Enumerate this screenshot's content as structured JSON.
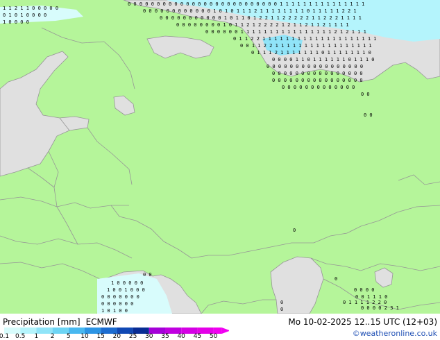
{
  "legend": {
    "title": "Precipitation [mm]",
    "model": "ECMWF",
    "run": "Mo 10-02-2025 12..15 UTC (12+03)",
    "credit": "©weatheronline.co.uk",
    "scale": [
      {
        "label": "0.1",
        "color": "#d8fcfc"
      },
      {
        "label": "0.5",
        "color": "#b4f4fc"
      },
      {
        "label": "1",
        "color": "#90e4f8"
      },
      {
        "label": "2",
        "color": "#6cd4f4"
      },
      {
        "label": "5",
        "color": "#48b8f0"
      },
      {
        "label": "10",
        "color": "#2c94e4"
      },
      {
        "label": "15",
        "color": "#1c6cd0"
      },
      {
        "label": "20",
        "color": "#1048b4"
      },
      {
        "label": "25",
        "color": "#082c94"
      },
      {
        "label": "30",
        "color": "#a400d8"
      },
      {
        "label": "35",
        "color": "#c000e0"
      },
      {
        "label": "40",
        "color": "#d400e4"
      },
      {
        "label": "45",
        "color": "#e400e8"
      },
      {
        "label": "50",
        "color": "#f000f0"
      }
    ]
  },
  "map": {
    "land_color": "#b5f59a",
    "sea_color": "#e0e0e0",
    "border_color": "#969696"
  }
}
